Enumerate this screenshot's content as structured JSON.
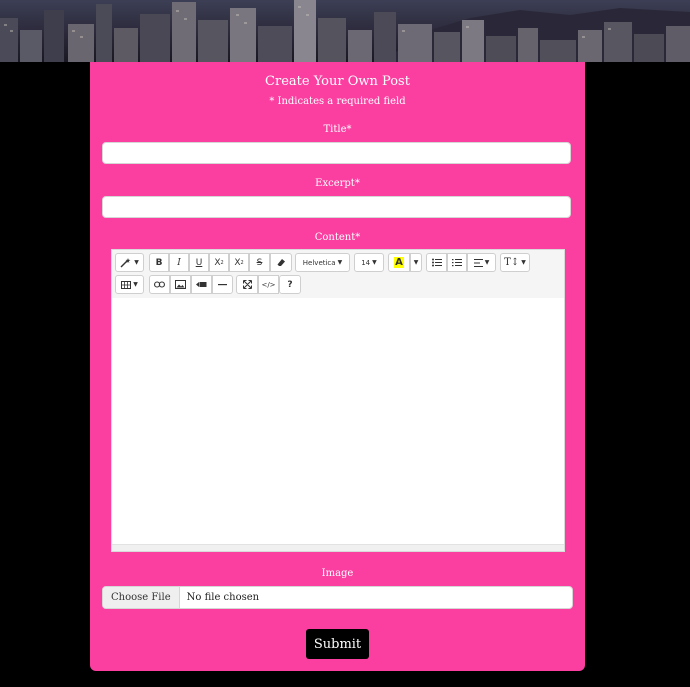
{
  "form": {
    "title": "Create Your Own Post",
    "required_note": "* Indicates a required field",
    "title_label": "Title*",
    "excerpt_label": "Excerpt*",
    "content_label": "Content*",
    "image_label": "Image",
    "submit_label": "Submit"
  },
  "editor_toolbar": {
    "font_name": "Helvetica",
    "font_size": "14",
    "bold": "B",
    "italic": "I",
    "underline": "U",
    "superscript": "X",
    "subscript": "X",
    "strikethrough": "S",
    "help": "?",
    "codeview": "</>"
  },
  "file_input": {
    "button_label": "Choose File",
    "status": "No file chosen"
  },
  "colors": {
    "card_background": "#fa3fa0",
    "page_background": "#000000",
    "submit_background": "#000000",
    "highlight_color": "#ffff00"
  },
  "icons": [
    "magic-icon",
    "eraser-icon",
    "highlight-color-icon",
    "unordered-list-icon",
    "ordered-list-icon",
    "align-icon",
    "line-height-icon",
    "table-icon",
    "link-icon",
    "picture-icon",
    "video-icon",
    "horizontal-rule-icon",
    "fullscreen-icon",
    "codeview-icon",
    "help-icon"
  ]
}
